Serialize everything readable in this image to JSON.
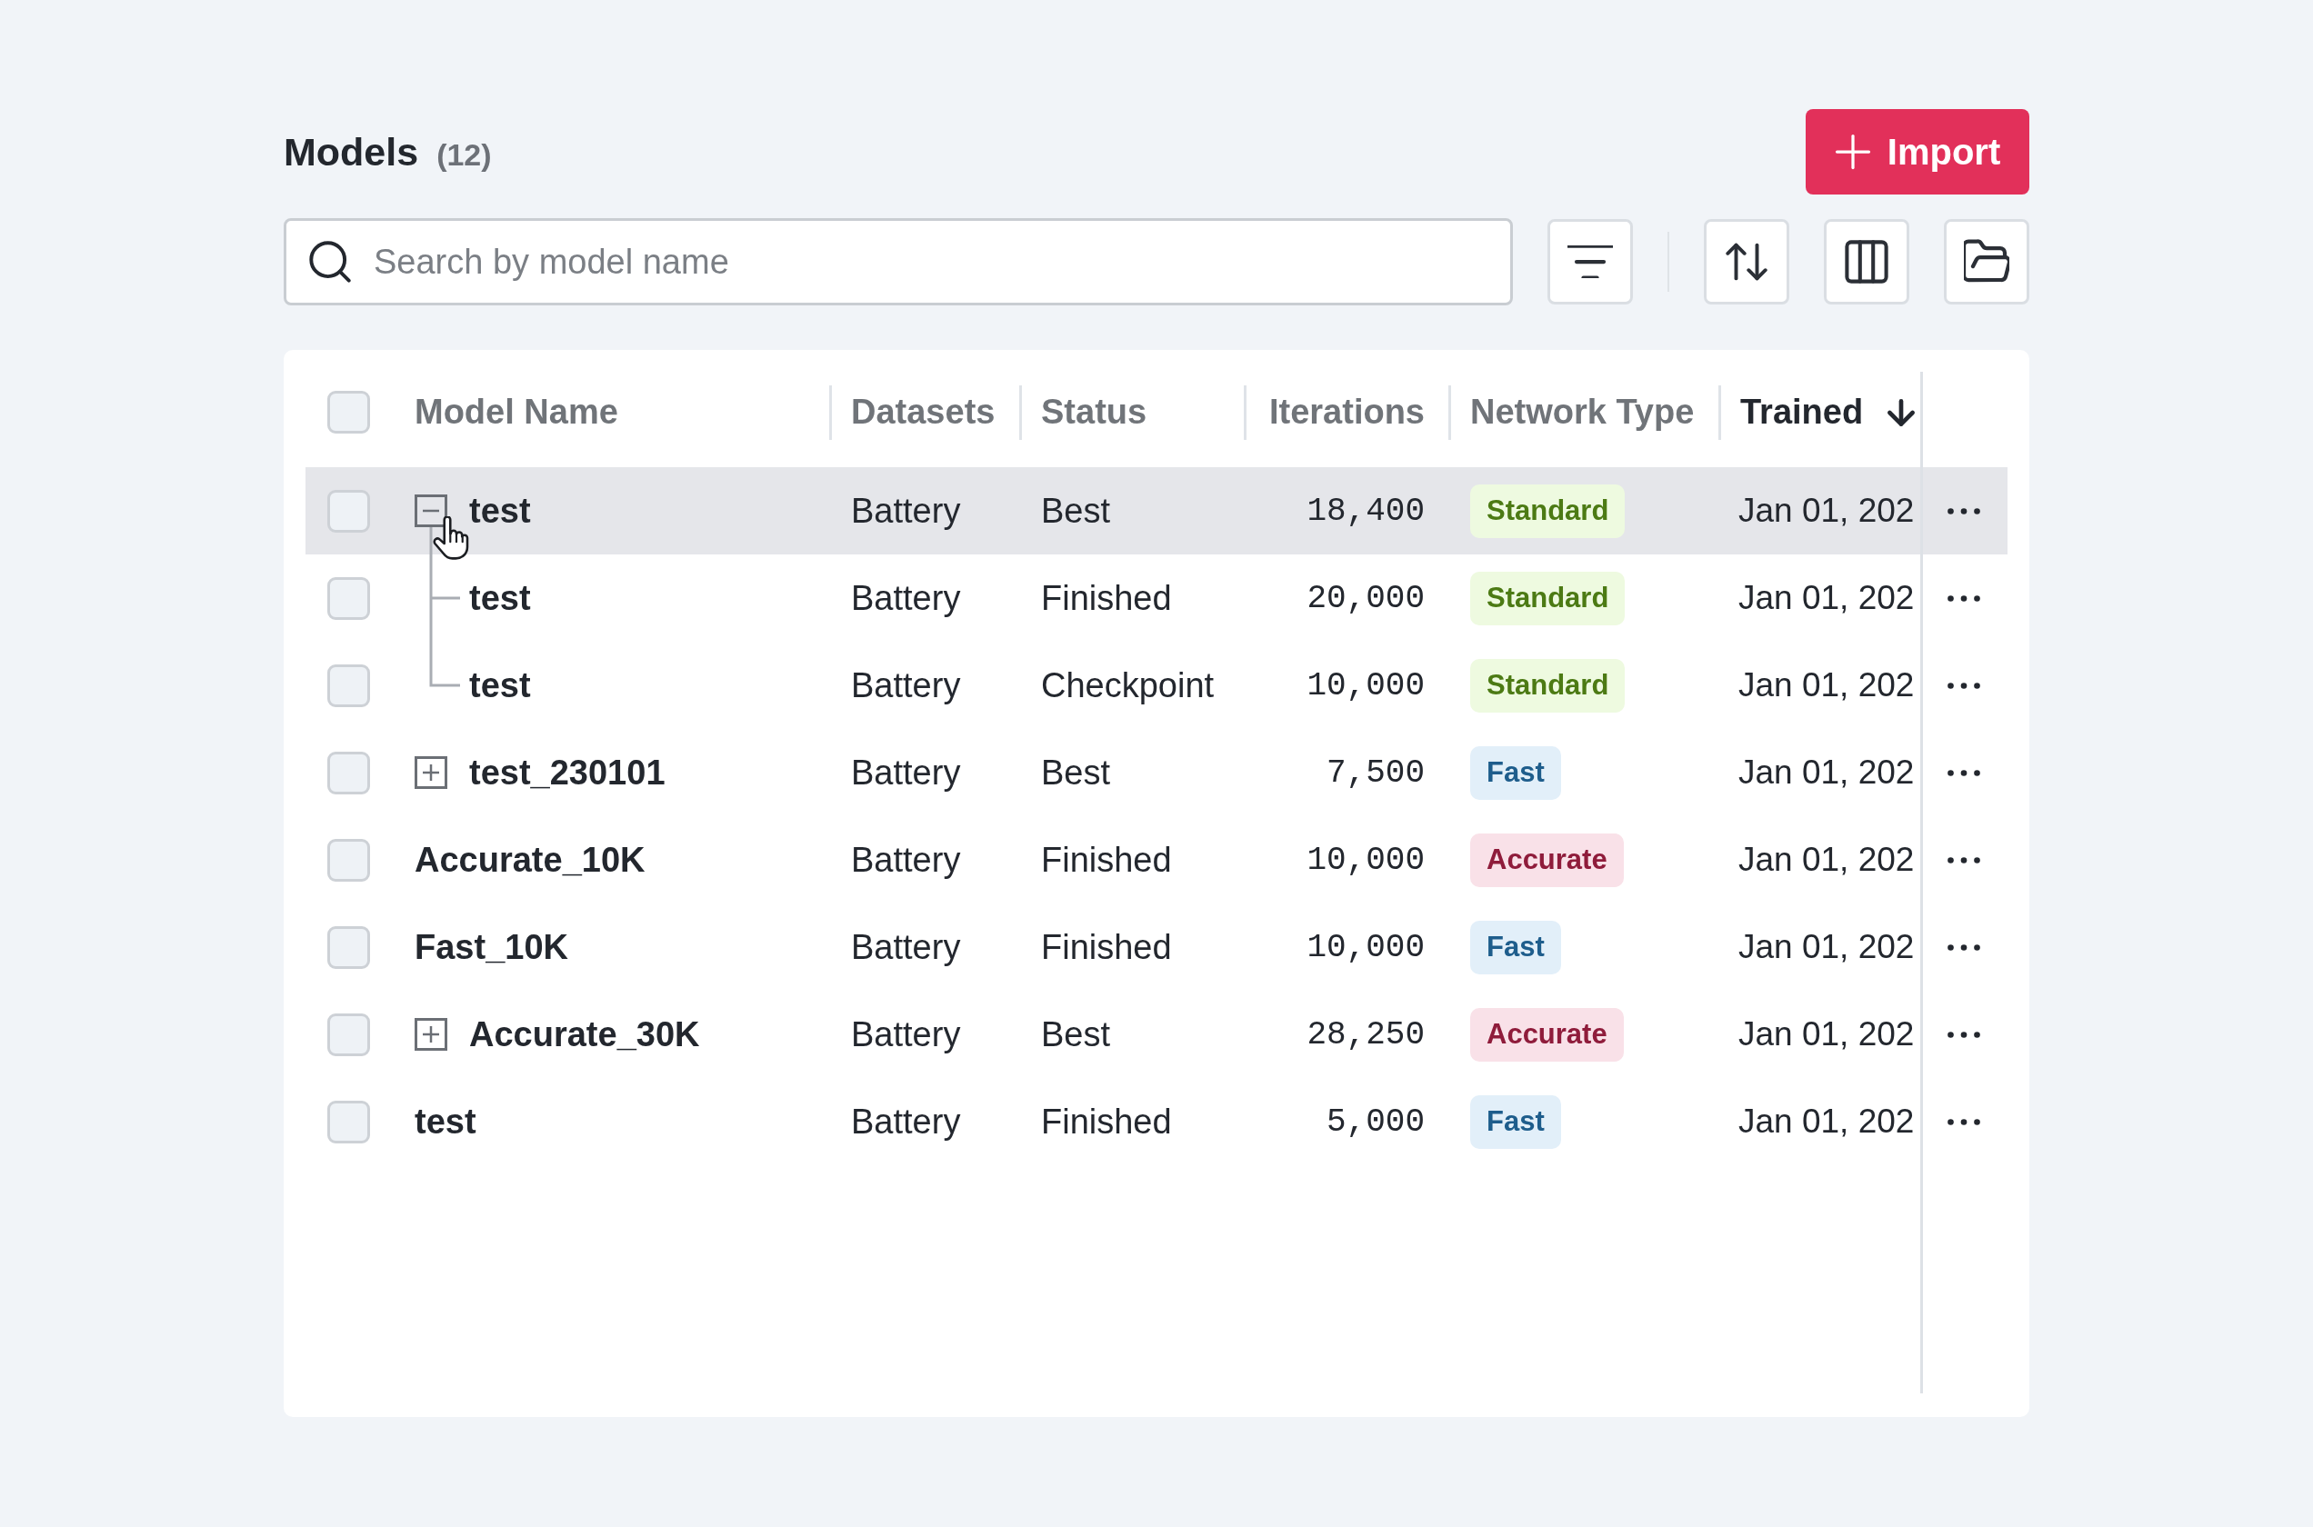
{
  "header": {
    "title": "Models",
    "count": "(12)",
    "import_button": {
      "label": "Import"
    }
  },
  "toolbar": {
    "search": {
      "placeholder": "Search by model name"
    }
  },
  "table": {
    "select_all": {
      "checked": false
    },
    "columns": [
      {
        "label": "Model Name",
        "sorted": false
      },
      {
        "label": "Datasets",
        "sorted": false
      },
      {
        "label": "Status",
        "sorted": false
      },
      {
        "label": "Iterations",
        "sorted": false
      },
      {
        "label": "Network Type",
        "sorted": false
      },
      {
        "label": "Trained",
        "sorted": true,
        "descending": true
      }
    ],
    "rows": [
      {
        "kind": "group",
        "expanded": true,
        "hovered": true,
        "checked": false,
        "name": "test",
        "dataset": "Battery",
        "status": "Best",
        "iterations": "18,400",
        "network_type": {
          "label": "Standard",
          "color": "#4c7a14"
        },
        "trained": "Jan 01, 202",
        "children": [
          {
            "hovered": false,
            "checked": false,
            "name": "test",
            "dataset": "Battery",
            "status": "Finished",
            "iterations": "20,000",
            "network_type": {
              "label": "Standard",
              "color": "#4c7a14"
            },
            "trained": "Jan 01, 202"
          },
          {
            "hovered": false,
            "checked": false,
            "name": "test",
            "dataset": "Battery",
            "status": "Checkpoint",
            "iterations": "10,000",
            "network_type": {
              "label": "Standard",
              "color": "#4c7a14"
            },
            "trained": "Jan 01, 202"
          }
        ]
      },
      {
        "kind": "group",
        "expanded": false,
        "hovered": false,
        "checked": false,
        "name": "test_230101",
        "dataset": "Battery",
        "status": "Best",
        "iterations": "7,500",
        "network_type": {
          "label": "Fast",
          "color": "#1e5d8c"
        },
        "trained": "Jan 01, 202"
      },
      {
        "kind": "item",
        "hovered": false,
        "checked": false,
        "name": "Accurate_10K",
        "dataset": "Battery",
        "status": "Finished",
        "iterations": "10,000",
        "network_type": {
          "label": "Accurate",
          "color": "#8f1c3b"
        },
        "trained": "Jan 01, 202"
      },
      {
        "kind": "item",
        "hovered": false,
        "checked": false,
        "name": "Fast_10K",
        "dataset": "Battery",
        "status": "Finished",
        "iterations": "10,000",
        "network_type": {
          "label": "Fast",
          "color": "#1e5d8c"
        },
        "trained": "Jan 01, 202"
      },
      {
        "kind": "group",
        "expanded": false,
        "hovered": false,
        "checked": false,
        "name": "Accurate_30K",
        "dataset": "Battery",
        "status": "Best",
        "iterations": "28,250",
        "network_type": {
          "label": "Accurate",
          "color": "#8f1c3b"
        },
        "trained": "Jan 01, 202"
      },
      {
        "kind": "item",
        "hovered": false,
        "checked": false,
        "name": "test",
        "dataset": "Battery",
        "status": "Finished",
        "iterations": "5,000",
        "network_type": {
          "label": "Fast",
          "color": "#1e5d8c"
        },
        "trained": "Jan 01, 202"
      }
    ]
  }
}
